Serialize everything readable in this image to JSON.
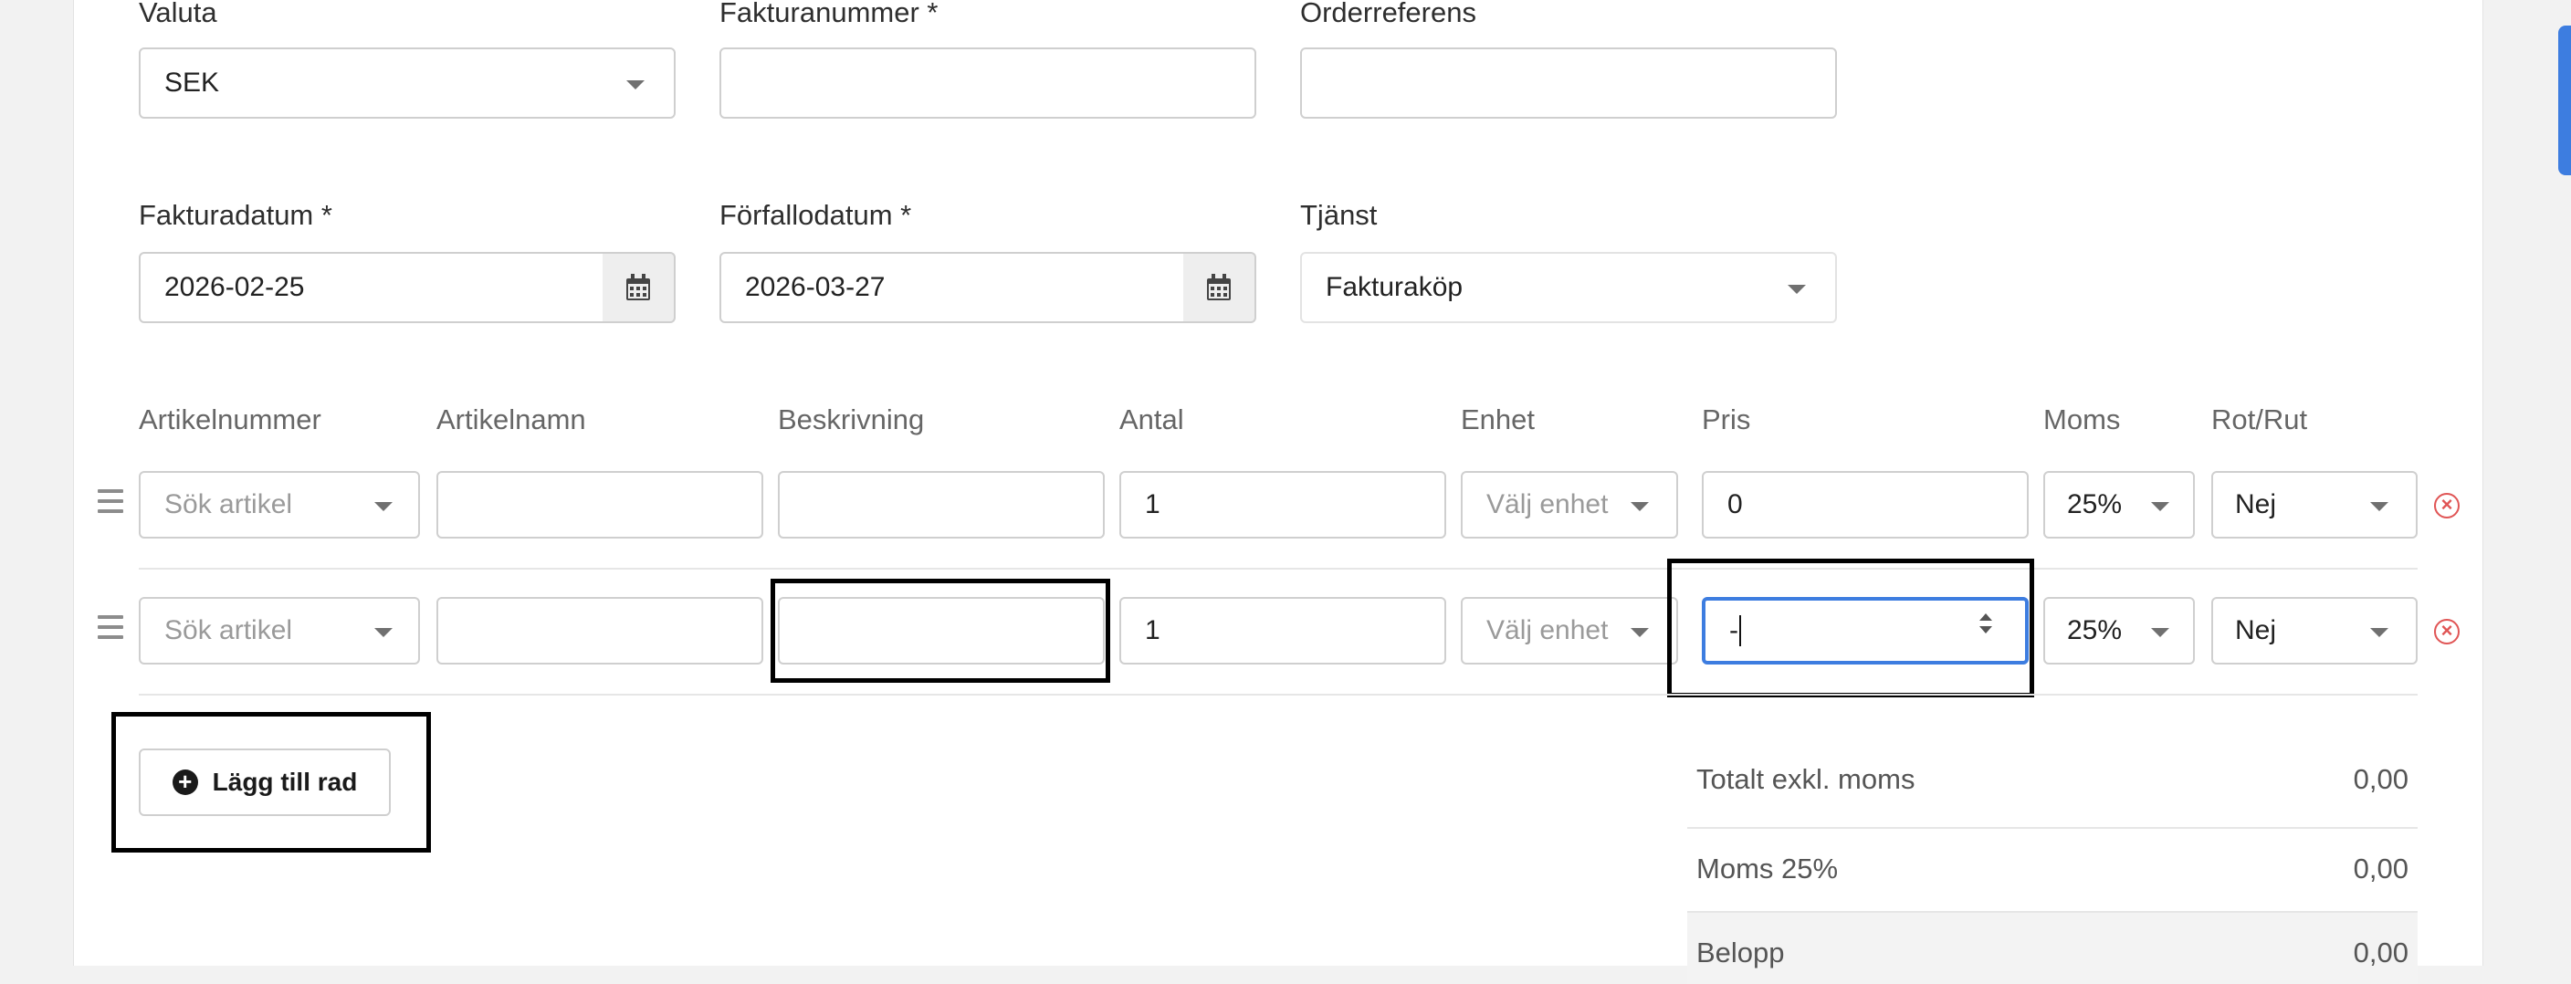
{
  "header_fields": {
    "currency": {
      "label": "Valuta",
      "value": "SEK"
    },
    "invoice_number": {
      "label": "Fakturanummer *",
      "value": ""
    },
    "order_reference": {
      "label": "Orderreferens",
      "value": ""
    },
    "invoice_date": {
      "label": "Fakturadatum *",
      "value": "2026-02-25"
    },
    "due_date": {
      "label": "Förfallodatum *",
      "value": "2026-03-27"
    },
    "service": {
      "label": "Tjänst",
      "value": "Fakturaköp"
    }
  },
  "columns": [
    "Artikelnummer",
    "Artikelnamn",
    "Beskrivning",
    "Antal",
    "Enhet",
    "Pris",
    "Moms",
    "Rot/Rut"
  ],
  "rows": [
    {
      "article_placeholder": "Sök artikel",
      "name": "",
      "description": "",
      "quantity": "1",
      "unit_placeholder": "Välj enhet",
      "price": "0",
      "vat": "25%",
      "rot_rut": "Nej"
    },
    {
      "article_placeholder": "Sök artikel",
      "name": "",
      "description": "",
      "quantity": "1",
      "unit_placeholder": "Välj enhet",
      "price": "-",
      "vat": "25%",
      "rot_rut": "Nej"
    }
  ],
  "add_row_label": "Lägg till rad",
  "summary": {
    "excl_vat": {
      "label": "Totalt exkl. moms",
      "value": "0,00"
    },
    "vat": {
      "label": "Moms 25%",
      "value": "0,00"
    },
    "amount": {
      "label": "Belopp",
      "value": "0,00"
    }
  },
  "colors": {
    "accent": "#3d7de0",
    "remove": "#e05555"
  }
}
